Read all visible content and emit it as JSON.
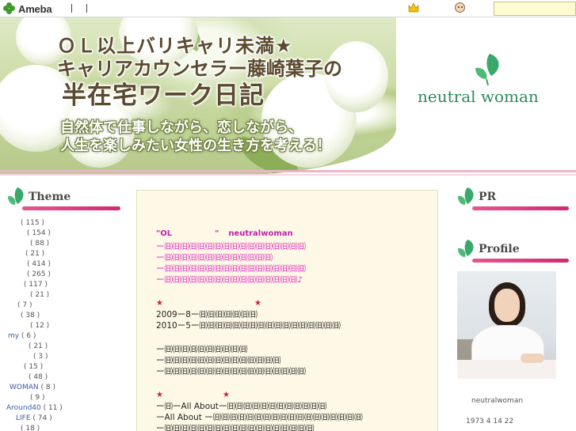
{
  "topbar": {
    "logo_text": "Ameba",
    "search_value": ""
  },
  "banner": {
    "title_lines": [
      "ＯＬ以上バリキャリ未満★",
      "キャリアカウンセラー藤崎葉子の",
      "半在宅ワーク日記"
    ],
    "subtitle_lines": [
      "自然体で仕事しながら、恋しながら、",
      "人生を楽しみたい女性の生き方を考える！"
    ],
    "brand": "neutral woman",
    "brand_color": "#2f8a5a"
  },
  "sidebar_left": {
    "heading": "Theme",
    "items": [
      {
        "name": "",
        "count": "( 115 )"
      },
      {
        "name": "",
        "count": "( 154 )"
      },
      {
        "name": "",
        "count": "( 88 )"
      },
      {
        "name": "",
        "count": "( 21 )"
      },
      {
        "name": "",
        "count": "( 414 )"
      },
      {
        "name": "",
        "count": "( 265 )"
      },
      {
        "name": "",
        "count": "( 117 )"
      },
      {
        "name": "",
        "count": "( 21 )"
      },
      {
        "name": "",
        "count": "( 7 )"
      },
      {
        "name": "",
        "count": "( 38 )"
      },
      {
        "name": "",
        "count": "( 12 )"
      },
      {
        "name": "my",
        "count": "( 6 )"
      },
      {
        "name": "",
        "count": "( 21 )"
      },
      {
        "name": "",
        "count": "( 3 )"
      },
      {
        "name": "",
        "count": "( 15 )"
      },
      {
        "name": "",
        "count": "( 48 )"
      },
      {
        "name": "WOMAN",
        "count": "( 8 )"
      },
      {
        "name": "",
        "count": "( 9 )"
      },
      {
        "name": "Around40",
        "count": "( 11 )"
      },
      {
        "name": "LIFE",
        "count": "( 74 )"
      },
      {
        "name": "",
        "count": "( 18 )"
      }
    ]
  },
  "article": {
    "heading_left": "\"OL",
    "heading_mid": "\"",
    "heading_right": "neutralwoman",
    "pink_lines": [
      "ー㈰㈰㈰㈰㈰㈰㈰㈰㈰㈰㈰㈰㈰㈰㈰㈰㈰",
      "ー㈰㈰㈰㈰㈰㈰㈰㈰㈰㈰㈰㈰㈰",
      "ー㈰㈰㈰㈰㈰㈰㈰㈰㈰㈰㈰㈰㈰㈰㈰㈰㈰",
      "ー㈰㈰㈰㈰㈰㈰㈰㈰㈰㈰㈰㈰㈰㈰㈰㈰♪"
    ],
    "star": "★",
    "block1": [
      "2009ー8ー㈰㈰㈰㈰㈰㈰㈰",
      "2010ー5ー㈰㈰㈰㈰㈰㈰㈰㈰㈰㈰㈰㈰㈰㈰㈰㈰㈰"
    ],
    "block2": [
      "ー㈰㈰㈰㈰㈰㈰㈰㈰㈰㈰",
      "ー㈰㈰㈰㈰㈰㈰㈰㈰㈰㈰㈰㈰㈰㈰",
      "ー㈰㈰㈰㈰㈰㈰㈰㈰㈰㈰㈰㈰㈰㈰㈰㈰㈰"
    ],
    "block3": [
      "ー㈰ーAll Aboutー㈰㈰㈰㈰㈰㈰㈰㈰㈰㈰㈰㈰",
      "ーAll About ー㈰㈰㈰㈰㈰㈰㈰㈰㈰㈰㈰㈰㈰㈰㈰㈰㈰㈰",
      "ー㈰㈰㈰㈰㈰㈰㈰㈰㈰㈰㈰㈰㈰㈰㈰㈰㈰㈰"
    ]
  },
  "sidebar_right": {
    "pr_heading": "PR",
    "profile_heading": "Profile",
    "profile_name": "neutralwoman",
    "profile_birth": "1973 4 14  22"
  },
  "colors": {
    "accent_pink": "#e020c0",
    "heading_bar": "#d02a72",
    "leaf_green": "#3aa86a"
  }
}
